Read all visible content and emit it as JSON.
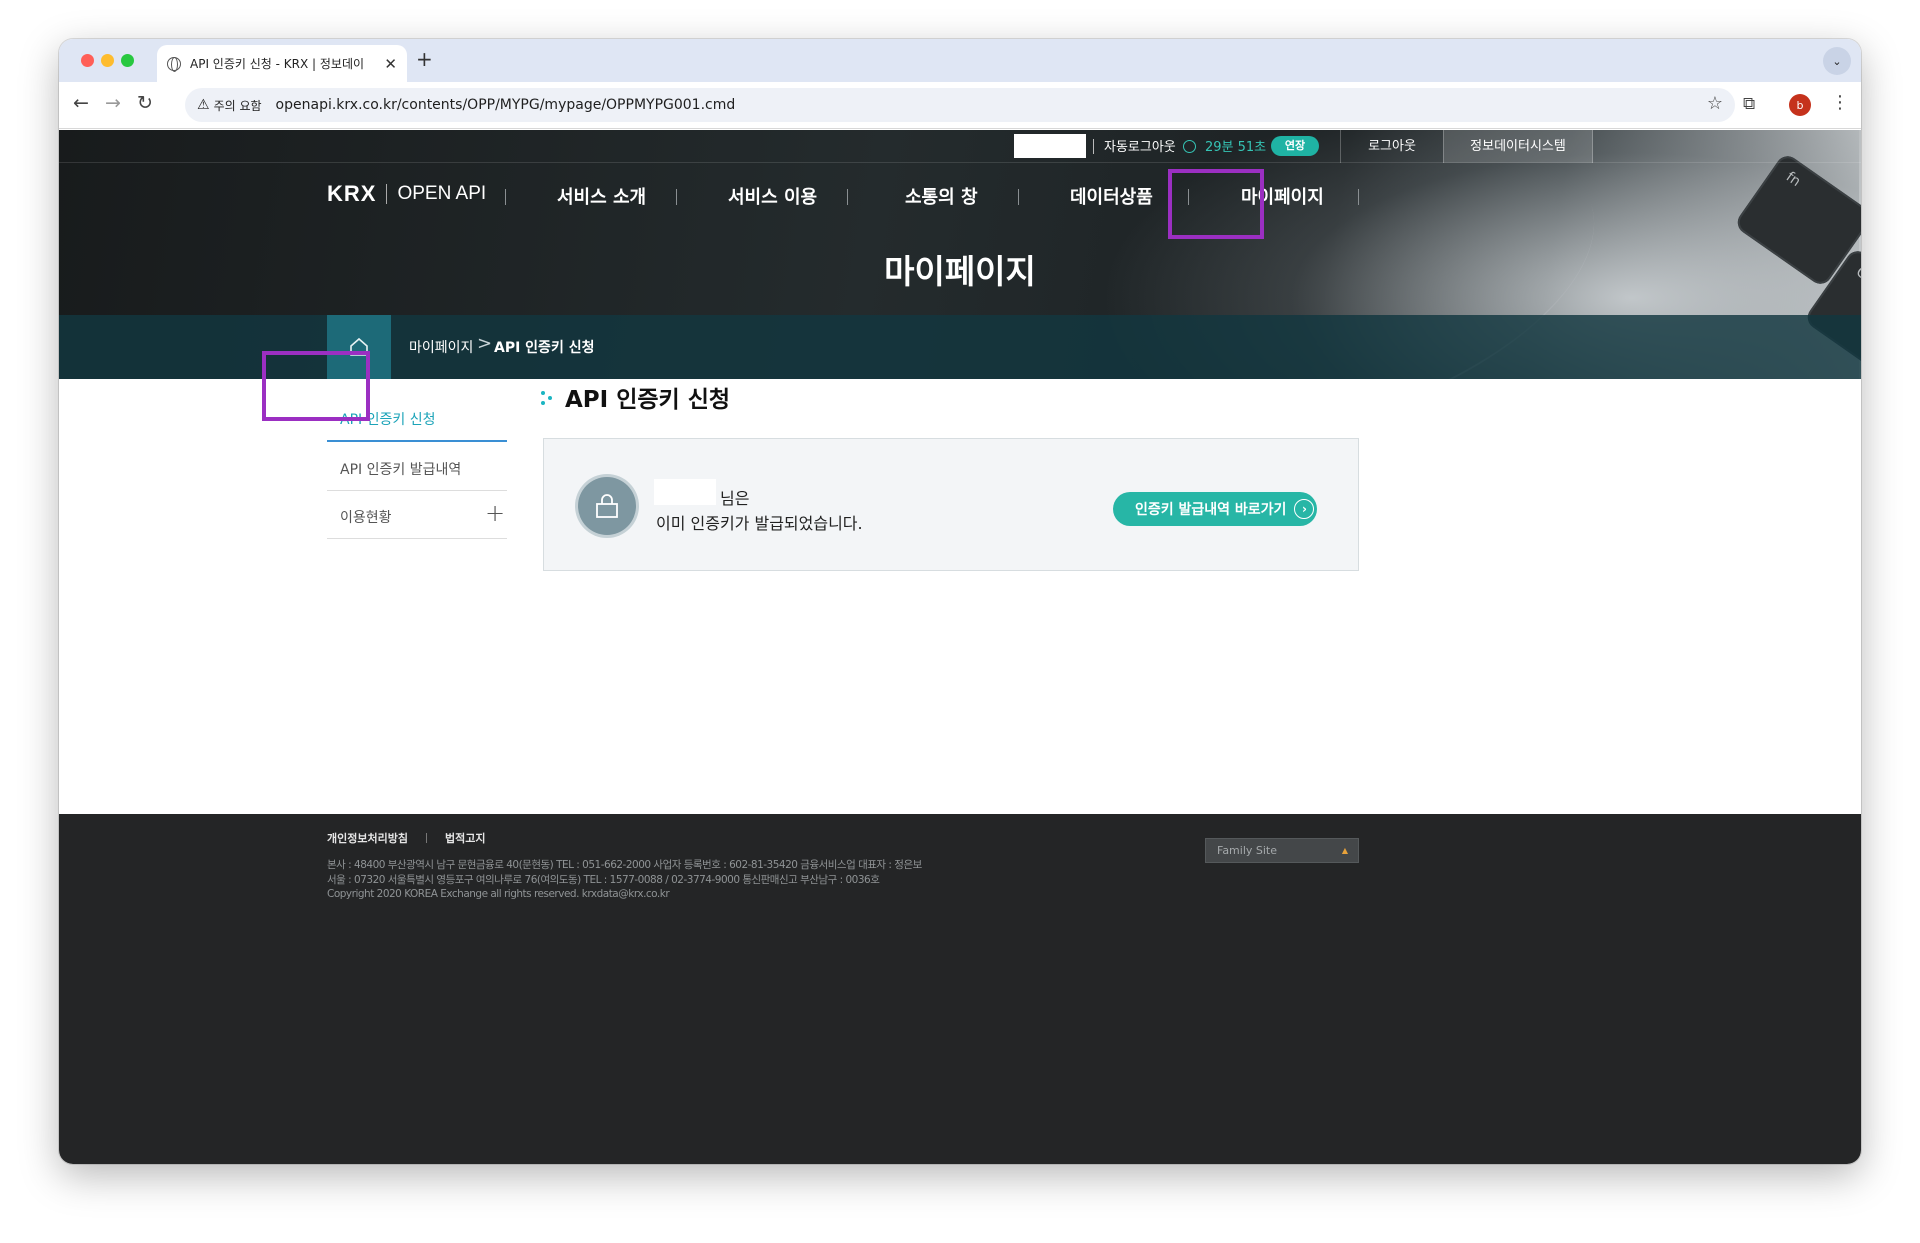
{
  "browser": {
    "tab_title": "API 인증키 신청 - KRX | 정보데이",
    "tab_close": "✕",
    "new_tab": "+",
    "tab_menu": "⌄",
    "nav_back": "←",
    "nav_forward": "→",
    "nav_reload": "↻",
    "security_chip": "주의 요함",
    "url": "openapi.krx.co.kr/contents/OPP/MYPG/mypage/OPPMYPG001.cmd",
    "profile_initial": "b"
  },
  "topbar": {
    "auto_logout_label": "자동로그아웃",
    "timer": "29분 51초",
    "extend_label": "연장",
    "logout_label": "로그아웃",
    "data_system_label": "정보데이터시스템"
  },
  "gnb": {
    "logo_krx": "KRX",
    "logo_openapi": "OPEN API",
    "items": [
      {
        "label": "서비스 소개"
      },
      {
        "label": "서비스 이용"
      },
      {
        "label": "소통의 창"
      },
      {
        "label": "데이터상품"
      },
      {
        "label": "마이페이지"
      }
    ]
  },
  "hero": {
    "title": "마이페이지",
    "key1": "fn",
    "key2": "Ctrl"
  },
  "breadcrumb": {
    "level1": "마이페이지",
    "separator": ">",
    "level2": "API 인증키 신청"
  },
  "sidebar": {
    "items": [
      {
        "label": "API 인증키 신청",
        "active": true
      },
      {
        "label": "API 인증키 발급내역"
      },
      {
        "label": "이용현황",
        "expand_icon": "+"
      }
    ]
  },
  "main": {
    "title": "API 인증키 신청",
    "name_suffix": "님은",
    "issued_message": "이미 인증키가 발급되었습니다.",
    "goto_button": "인증키 발급내역 바로가기",
    "goto_arrow": "›"
  },
  "footer": {
    "links": [
      "개인정보처리방침",
      "법적고지"
    ],
    "address_lines": [
      "본사 : 48400 부산광역시 남구 문현금융로 40(문현동) TEL : 051-662-2000 사업자 등록번호 : 602-81-35420 금융서비스업 대표자 : 정은보",
      "서울 : 07320 서울특별시 영등포구 여의나루로 76(여의도동) TEL : 1577-0088 / 02-3774-9000 통신판매신고 부산남구 : 0036호",
      "Copyright 2020 KOREA Exchange all rights reserved. krxdata@krx.co.kr"
    ],
    "family_site": "Family Site",
    "family_site_caret": "▲"
  },
  "colors": {
    "accent_teal": "#27b6a6",
    "highlight_purple": "#9b2fc2",
    "breadcrumb_bg": "#123740"
  }
}
